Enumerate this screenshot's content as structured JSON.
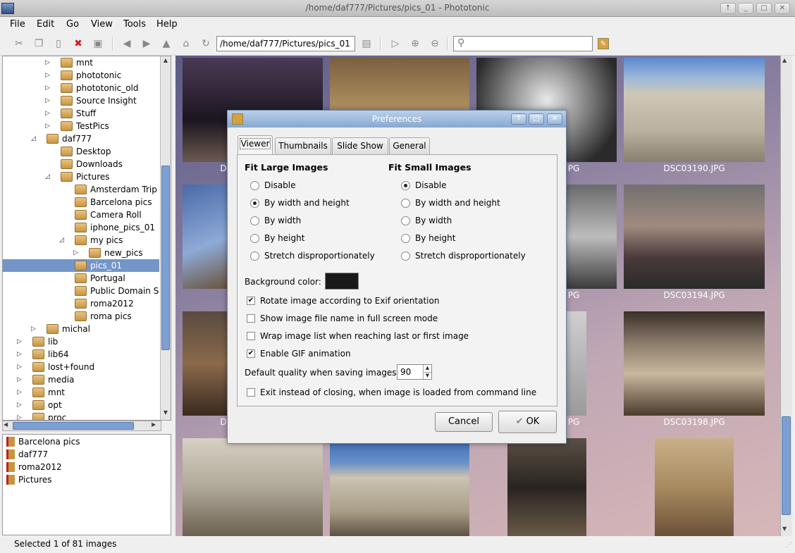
{
  "window": {
    "title": "/home/daf777/Pictures/pics_01 - Phototonic",
    "controls": [
      "↑",
      "_",
      "□",
      "✕"
    ]
  },
  "menu": [
    "File",
    "Edit",
    "Go",
    "View",
    "Tools",
    "Help"
  ],
  "toolbar": {
    "path": "/home/daf777/Pictures/pics_01",
    "search_placeholder": ""
  },
  "tree": [
    {
      "label": "mnt",
      "depth": 3,
      "arrow": "▷"
    },
    {
      "label": "phototonic",
      "depth": 3,
      "arrow": "▷"
    },
    {
      "label": "phototonic_old",
      "depth": 3,
      "arrow": "▷"
    },
    {
      "label": "Source Insight",
      "depth": 3,
      "arrow": "▷"
    },
    {
      "label": "Stuff",
      "depth": 3,
      "arrow": "▷"
    },
    {
      "label": "TestPics",
      "depth": 3,
      "arrow": "▷"
    },
    {
      "label": "daf777",
      "depth": 2,
      "arrow": "◿"
    },
    {
      "label": "Desktop",
      "depth": 3,
      "arrow": ""
    },
    {
      "label": "Downloads",
      "depth": 3,
      "arrow": ""
    },
    {
      "label": "Pictures",
      "depth": 3,
      "arrow": "◿"
    },
    {
      "label": "Amsterdam Trip",
      "depth": 4,
      "arrow": ""
    },
    {
      "label": "Barcelona pics",
      "depth": 4,
      "arrow": ""
    },
    {
      "label": "Camera Roll",
      "depth": 4,
      "arrow": ""
    },
    {
      "label": "iphone_pics_01",
      "depth": 4,
      "arrow": ""
    },
    {
      "label": "my pics",
      "depth": 4,
      "arrow": "◿"
    },
    {
      "label": "new_pics",
      "depth": 5,
      "arrow": "▷"
    },
    {
      "label": "pics_01",
      "depth": 4,
      "arrow": "",
      "selected": true
    },
    {
      "label": "Portugal",
      "depth": 4,
      "arrow": ""
    },
    {
      "label": "Public Domain S",
      "depth": 4,
      "arrow": ""
    },
    {
      "label": "roma2012",
      "depth": 4,
      "arrow": ""
    },
    {
      "label": "roma pics",
      "depth": 4,
      "arrow": ""
    },
    {
      "label": "michal",
      "depth": 2,
      "arrow": "▷"
    },
    {
      "label": "lib",
      "depth": 1,
      "arrow": "▷"
    },
    {
      "label": "lib64",
      "depth": 1,
      "arrow": "▷"
    },
    {
      "label": "lost+found",
      "depth": 1,
      "arrow": "▷"
    },
    {
      "label": "media",
      "depth": 1,
      "arrow": "▷"
    },
    {
      "label": "mnt",
      "depth": 1,
      "arrow": "▷"
    },
    {
      "label": "opt",
      "depth": 1,
      "arrow": "▷"
    },
    {
      "label": "proc",
      "depth": 1,
      "arrow": "▷"
    }
  ],
  "bookmarks": [
    "Barcelona pics",
    "daf777",
    "roma2012",
    "Pictures"
  ],
  "thumb_captions": [
    "DSC03190.JPG",
    "DSC03194.JPG",
    "DSC03198.JPG"
  ],
  "thumb_caption_fragments": [
    "D",
    "PG",
    "D",
    "PG",
    "D",
    "PG"
  ],
  "status": "Selected 1 of 81 images",
  "dialog": {
    "title": "Preferences",
    "tabs": [
      "Viewer",
      "Thumbnails",
      "Slide Show",
      "General"
    ],
    "fit_large_title": "Fit Large Images",
    "fit_small_title": "Fit Small Images",
    "fit_large_options": [
      "Disable",
      "By width and height",
      "By width",
      "By height",
      "Stretch disproportionately"
    ],
    "fit_large_selected": 1,
    "fit_small_options": [
      "Disable",
      "By width and height",
      "By width",
      "By height",
      "Stretch disproportionately"
    ],
    "fit_small_selected": 0,
    "bg_color_label": "Background color:",
    "bg_color": "#1a1a1a",
    "checks": [
      {
        "label": "Rotate image according to Exif orientation",
        "checked": true
      },
      {
        "label": "Show image file name in full screen mode",
        "checked": false
      },
      {
        "label": "Wrap image list when reaching last or first image",
        "checked": false
      },
      {
        "label": "Enable GIF animation",
        "checked": true
      }
    ],
    "quality_label": "Default quality when saving images:",
    "quality_value": "90",
    "exit_label": "Exit instead of closing, when image is loaded from command line",
    "exit_checked": false,
    "cancel_label": "Cancel",
    "ok_label": "OK"
  }
}
